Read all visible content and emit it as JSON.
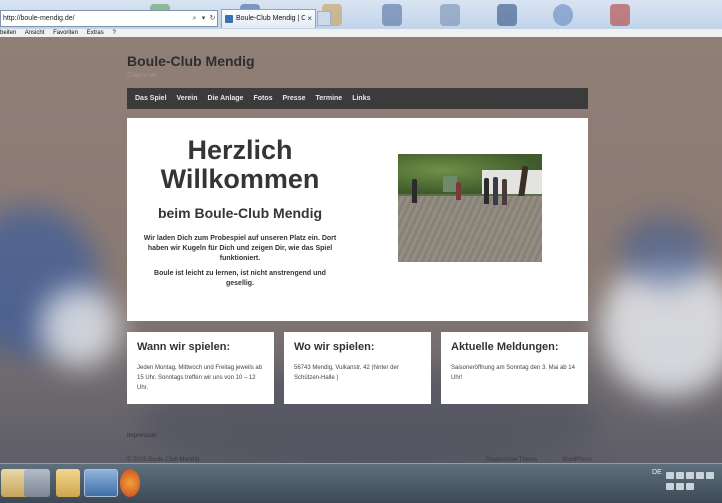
{
  "browser": {
    "url": "http://boule-mendig.de/",
    "tab_title": "Boule-Club Mendig | C'est l...",
    "tab_close": "×",
    "menu": [
      "beiten",
      "Ansicht",
      "Favoriten",
      "Extras",
      "?"
    ],
    "addr_search_icon": "search-icon",
    "addr_refresh_icon": "refresh-icon"
  },
  "site": {
    "title": "Boule-Club Mendig",
    "tagline": "C'est la vie",
    "nav": [
      "Das Spiel",
      "Verein",
      "Die Anlage",
      "Fotos",
      "Presse",
      "Termine",
      "Links"
    ]
  },
  "hero": {
    "heading_line1": "Herzlich",
    "heading_line2": "Willkommen",
    "subheading": "beim Boule-Club Mendig",
    "para1": "Wir laden Dich zum Probespiel auf unseren Platz ein. Dort haben wir Kugeln für Dich und zeigen Dir, wie das Spiel funktioniert.",
    "para2": "Boule ist leicht zu lernen, ist nicht anstrengend und gesellig."
  },
  "cards": [
    {
      "title": "Wann wir spielen:",
      "text": "Jeden Montag, Mittwoch und Freitag jeweils ab 15 Uhr. Sonntags treffen wir uns von 10 – 12 Uhr."
    },
    {
      "title": "Wo wir spielen:",
      "text": "56743 Mendig, Vulkanstr. 42 (hinter der Schützen-Halle )"
    },
    {
      "title": "Aktuelle Meldungen:",
      "text": "Saisoneröffnung am Sonntag den 3. Mai ab 14 Uhr!"
    }
  ],
  "footer": {
    "impressum": "Impressum",
    "copyright": "© 2015 Boule-Club Mendig",
    "theme": "Responsive Theme",
    "powered": "WordPress"
  },
  "taskbar": {
    "language": "DE"
  },
  "colors": {
    "nav_bg": "#3b3b3b",
    "page_bg": "#8c7c74",
    "content_bg": "#ffffff"
  }
}
